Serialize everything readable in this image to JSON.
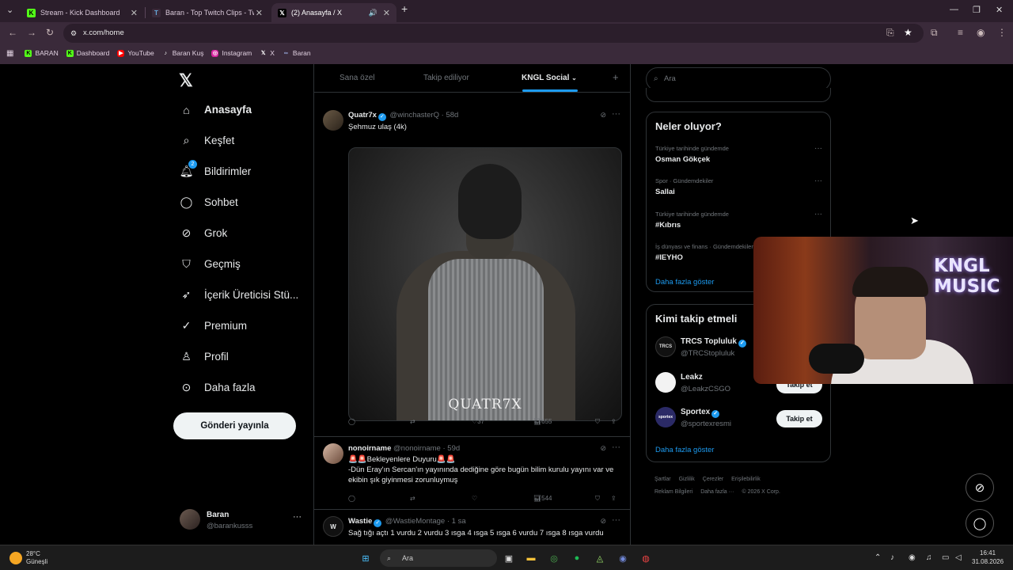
{
  "browser": {
    "tabs": [
      {
        "title": "Stream - Kick Dashboard",
        "icon": "kick-icon"
      },
      {
        "title": "Baran - Top Twitch Clips - Twitch",
        "icon": "twitch-clips-icon"
      },
      {
        "title": "(2) Anasayfa / X",
        "icon": "x-icon"
      }
    ],
    "url": "x.com/home",
    "bookmarks": [
      "BARAN",
      "Dashboard",
      "YouTube",
      "Baran Kuş",
      "Instagram",
      "X",
      "Baran"
    ]
  },
  "nav": {
    "items": [
      "Anasayfa",
      "Keşfet",
      "Bildirimler",
      "Sohbet",
      "Grok",
      "Geçmiş",
      "İçerik Üreticisi Stü...",
      "Premium",
      "Profil",
      "Daha fazla"
    ],
    "notifications_badge": "2",
    "post_button": "Gönderi yayınla",
    "profile_name": "Baran",
    "profile_handle": "@barankusss"
  },
  "timeline": {
    "tabs": [
      "Sana özel",
      "Takip ediliyor",
      "KNGL Social"
    ],
    "tweets": [
      {
        "name": "Quatr7x",
        "handle": "@winchasterQ",
        "age": "· 58d",
        "text": "Şehmuz ulaş (4k)",
        "media_watermark": "QUATR7X",
        "likes": "37",
        "views": "655"
      },
      {
        "name": "nonoirname",
        "handle": "@nonoirname",
        "age": "· 59d",
        "text_line1": "🚨🚨Bekleyenlere Duyuru🚨🚨",
        "text_line2": "-Dün Eray'ın Sercan'ın yayınında dediğine göre bugün bilim kurulu yayını var ve ekibin şık giyinmesi zorunluymuş",
        "views": "544"
      },
      {
        "name": "Wastie",
        "handle": "@WastieMontage",
        "age": "· 1 sa",
        "text": "Sağ tığı açtı 1 vurdu 2 vurdu 3 ısga 4 ısga 5 ısga 6 vurdu 7 ısga 8 ısga vurdu"
      }
    ]
  },
  "sidebar": {
    "search_placeholder": "Ara",
    "trends_title": "Neler oluyor?",
    "trends": [
      {
        "meta": "Türkiye tarihinde gündemde",
        "name": "Osman Gökçek"
      },
      {
        "meta": "Spor · Gündemdekiler",
        "name": "Sallai"
      },
      {
        "meta": "Türkiye tarihinde gündemde",
        "name": "#Kıbrıs"
      },
      {
        "meta": "İş dünyası ve finans · Gündemdekiler",
        "name": "#IEYHO"
      }
    ],
    "show_more": "Daha fazla göster",
    "wtf_title": "Kimi takip etmeli",
    "wtf": [
      {
        "name": "TRCS Topluluk",
        "handle": "@TRCStopluluk",
        "avatar_text": "TRCS"
      },
      {
        "name": "Leakz",
        "handle": "@LeakzCSGO",
        "avatar_text": ""
      },
      {
        "name": "Sportex",
        "handle": "@sportexresmi",
        "avatar_text": "sportex"
      }
    ],
    "follow_label": "Takip et",
    "footer": [
      "Şartlar",
      "Gizlilik",
      "Çerezler",
      "Erişilebilirlik",
      "Reklam Bilgileri",
      "Daha fazla ···",
      "© 2026 X Corp."
    ]
  },
  "webcam": {
    "sign": "KNGL MUSIC"
  },
  "taskbar": {
    "weather_temp": "28°C",
    "weather_desc": "Güneşli",
    "search": "Ara",
    "time": "16:41",
    "date": "31.08.2026"
  },
  "colors": {
    "accent": "#1d9bf0",
    "browser_frame": "#3a2a3a",
    "background": "#000000"
  }
}
